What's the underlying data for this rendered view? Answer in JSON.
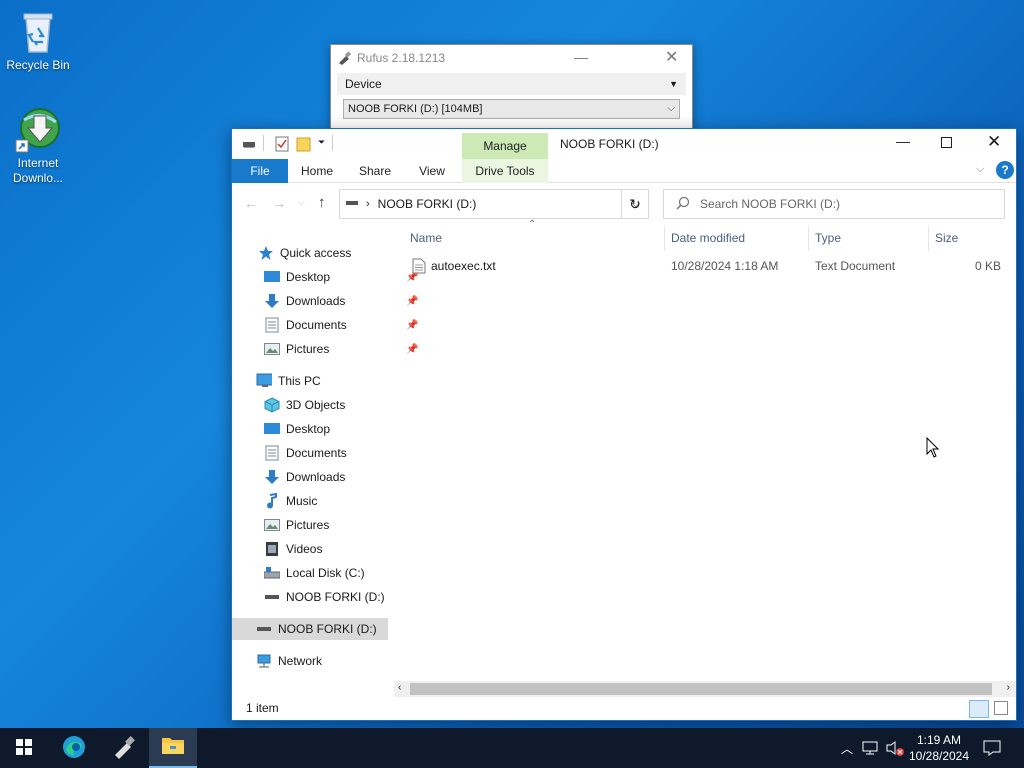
{
  "desktop": {
    "icons": [
      {
        "label": "Recycle Bin",
        "icon": "recycle-bin-icon"
      },
      {
        "label_line1": "Internet",
        "label_line2": "Downlo...",
        "icon": "internet-download-manager-icon"
      }
    ]
  },
  "rufus": {
    "title": "Rufus 2.18.1213",
    "section_label": "Device",
    "device_value": "NOOB  FORKI (D:) [104MB]"
  },
  "explorer": {
    "title": "NOOB  FORKI (D:)",
    "context_tab": "Manage",
    "tabs": [
      "File",
      "Home",
      "Share",
      "View",
      "Drive Tools"
    ],
    "address_path": "NOOB  FORKI (D:)",
    "search_placeholder": "Search NOOB  FORKI (D:)",
    "columns": [
      "Name",
      "Date modified",
      "Type",
      "Size"
    ],
    "files": [
      {
        "name": "autoexec.txt",
        "date": "10/28/2024 1:18 AM",
        "type": "Text Document",
        "size": "0 KB"
      }
    ],
    "nav": {
      "quick_access": "Quick access",
      "quick_items": [
        "Desktop",
        "Downloads",
        "Documents",
        "Pictures"
      ],
      "this_pc": "This PC",
      "pc_items": [
        "3D Objects",
        "Desktop",
        "Documents",
        "Downloads",
        "Music",
        "Pictures",
        "Videos",
        "Local Disk (C:)",
        "NOOB  FORKI (D:)"
      ],
      "drive_item": "NOOB  FORKI (D:)",
      "network": "Network"
    },
    "status": "1 item"
  },
  "taskbar": {
    "time": "1:19 AM",
    "date": "10/28/2024"
  },
  "colors": {
    "accent": "#1979ca",
    "manage_bg": "#cde9b5",
    "taskbar": "#0e1a2b"
  }
}
